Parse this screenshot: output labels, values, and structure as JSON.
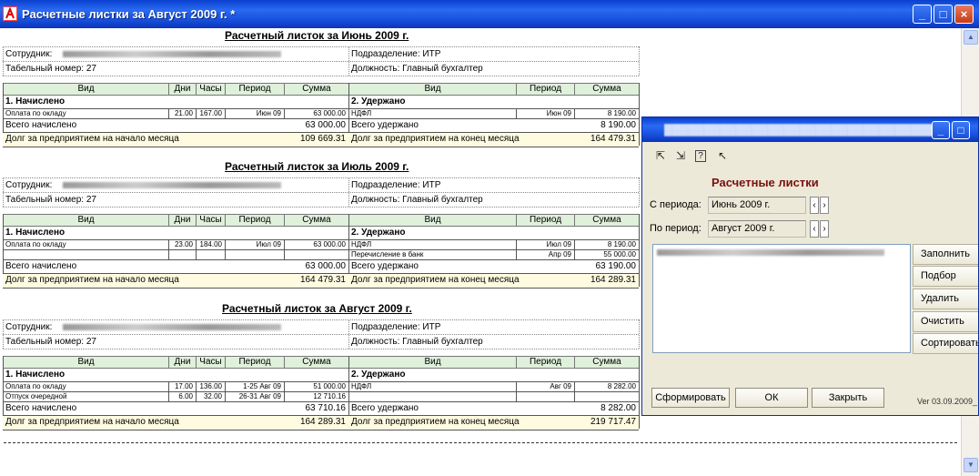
{
  "window": {
    "title": "Расчетные листки за Август 2009 г.  *"
  },
  "sheets": [
    {
      "title": "Расчетный листок за Июнь 2009 г.",
      "employee_label": "Сотрудник:",
      "tab_label": "Табельный номер: 27",
      "dept_label": "Подразделение: ИТР",
      "position_label": "Должность: Главный бухгалтер",
      "left_headers": [
        "Вид",
        "Дни",
        "Часы",
        "Период",
        "Сумма"
      ],
      "right_headers": [
        "Вид",
        "Период",
        "Сумма"
      ],
      "accrued_title": "1. Начислено",
      "withheld_title": "2. Удержано",
      "accrued_rows": [
        {
          "name": "Оплата по окладу",
          "days": "21.00",
          "hours": "167.00",
          "period": "Июн 09",
          "sum": "63 000.00"
        }
      ],
      "withheld_rows": [
        {
          "name": "НДФЛ",
          "period": "Июн 09",
          "sum": "8 190.00"
        }
      ],
      "total_accrued_label": "Всего начислено",
      "total_accrued": "63 000.00",
      "total_withheld_label": "Всего удержано",
      "total_withheld": "8 190.00",
      "debt_start_label": "Долг за предприятием на начало месяца",
      "debt_start": "109 669.31",
      "debt_end_label": "Долг за предприятием  на конец месяца",
      "debt_end": "164 479.31"
    },
    {
      "title": "Расчетный листок за Июль 2009 г.",
      "employee_label": "Сотрудник:",
      "tab_label": "Табельный номер: 27",
      "dept_label": "Подразделение: ИТР",
      "position_label": "Должность: Главный бухгалтер",
      "left_headers": [
        "Вид",
        "Дни",
        "Часы",
        "Период",
        "Сумма"
      ],
      "right_headers": [
        "Вид",
        "Период",
        "Сумма"
      ],
      "accrued_title": "1. Начислено",
      "withheld_title": "2. Удержано",
      "accrued_rows": [
        {
          "name": "Оплата по окладу",
          "days": "23.00",
          "hours": "184.00",
          "period": "Июл 09",
          "sum": "63 000.00"
        }
      ],
      "withheld_rows": [
        {
          "name": "НДФЛ",
          "period": "Июл 09",
          "sum": "8 190.00"
        },
        {
          "name": "Перечисление в банк",
          "period": "Апр 09",
          "sum": "55 000.00"
        }
      ],
      "total_accrued_label": "Всего начислено",
      "total_accrued": "63 000.00",
      "total_withheld_label": "Всего удержано",
      "total_withheld": "63 190.00",
      "debt_start_label": "Долг за предприятием на начало месяца",
      "debt_start": "164 479.31",
      "debt_end_label": "Долг за предприятием  на конец месяца",
      "debt_end": "164 289.31"
    },
    {
      "title": "Расчетный листок за Август 2009 г.",
      "employee_label": "Сотрудник:",
      "tab_label": "Табельный номер: 27",
      "dept_label": "Подразделение: ИТР",
      "position_label": "Должность: Главный бухгалтер",
      "left_headers": [
        "Вид",
        "Дни",
        "Часы",
        "Период",
        "Сумма"
      ],
      "right_headers": [
        "Вид",
        "Период",
        "Сумма"
      ],
      "accrued_title": "1. Начислено",
      "withheld_title": "2. Удержано",
      "accrued_rows": [
        {
          "name": "Оплата по окладу",
          "days": "17.00",
          "hours": "136.00",
          "period": "1-25 Авг 09",
          "sum": "51 000.00"
        },
        {
          "name": "Отпуск очередной",
          "days": "6.00",
          "hours": "32.00",
          "period": "26-31 Авг 09",
          "sum": "12 710.16"
        }
      ],
      "withheld_rows": [
        {
          "name": "НДФЛ",
          "period": "Авг 09",
          "sum": "8 282.00"
        }
      ],
      "total_accrued_label": "Всего начислено",
      "total_accrued": "63 710.16",
      "total_withheld_label": "Всего удержано",
      "total_withheld": "8 282.00",
      "debt_start_label": "Долг за предприятием на начало месяца",
      "debt_start": "164 289.31",
      "debt_end_label": "Долг за предприятием  на конец месяца",
      "debt_end": "219 717.47"
    }
  ],
  "dialog": {
    "heading": "Расчетные листки",
    "from_label": "С периода:",
    "from_value": "Июнь 2009 г.",
    "to_label": "По период:",
    "to_value": "Август 2009 г.",
    "side_buttons": [
      "Заполнить",
      "Подбор",
      "Удалить",
      "Очистить",
      "Сортировать"
    ],
    "bottom_buttons": [
      "Сформировать",
      "ОК",
      "Закрыть"
    ],
    "version": "Ver 03.09.2009_"
  }
}
